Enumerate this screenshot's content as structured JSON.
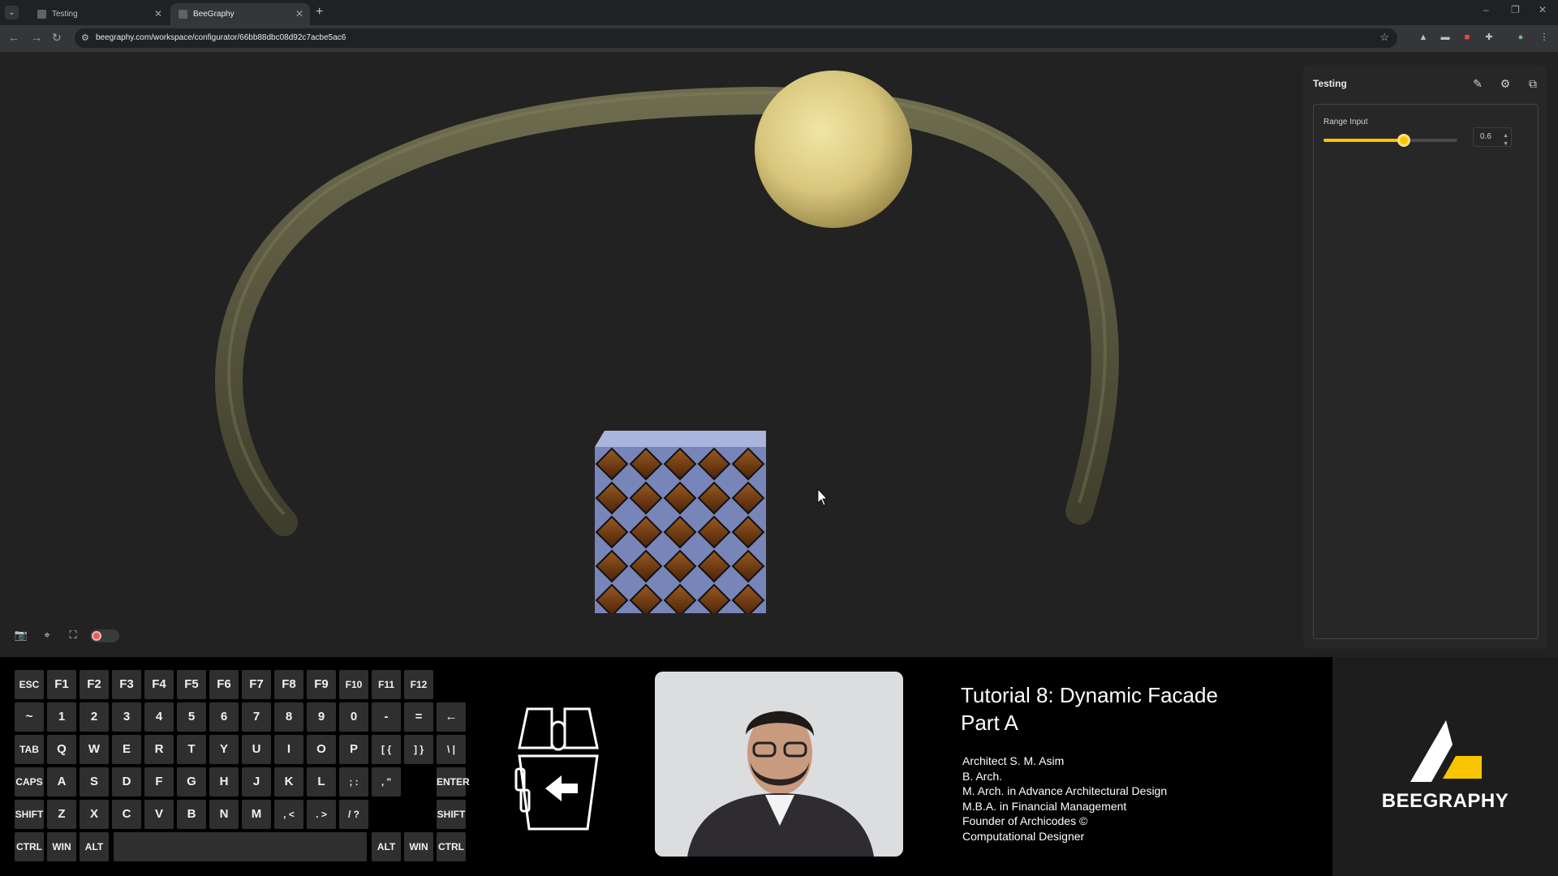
{
  "browser": {
    "tabs": [
      {
        "title": "Testing",
        "active": false
      },
      {
        "title": "BeeGraphy",
        "active": true
      }
    ],
    "url": "beegraphy.com/workspace/configurator/66bb88dbc08d92c7acbe5ac6"
  },
  "panel": {
    "title": "Testing",
    "range_input": {
      "label": "Range Input",
      "value": "0.6",
      "fill_fraction": 0.6
    }
  },
  "keyboard": {
    "rows": [
      [
        "ESC",
        "F1",
        "F2",
        "F3",
        "F4",
        "F5",
        "F6",
        "F7",
        "F8",
        "F9",
        "F10",
        "F11",
        "F12"
      ],
      [
        "~",
        "1",
        "2",
        "3",
        "4",
        "5",
        "6",
        "7",
        "8",
        "9",
        "0",
        "-",
        "=",
        "←"
      ],
      [
        "TAB",
        "Q",
        "W",
        "E",
        "R",
        "T",
        "Y",
        "U",
        "I",
        "O",
        "P",
        "[ {",
        "] }",
        "\\ |"
      ],
      [
        "CAPS",
        "A",
        "S",
        "D",
        "F",
        "G",
        "H",
        "J",
        "K",
        "L",
        "; :",
        ", \"",
        "ENTER"
      ],
      [
        "SHIFT",
        "Z",
        "X",
        "C",
        "V",
        "B",
        "N",
        "M",
        ", <",
        ". >",
        "/ ?",
        "SHIFT"
      ],
      [
        "CTRL",
        "WIN",
        "ALT",
        "ALT",
        "WIN",
        "CTRL"
      ]
    ]
  },
  "tutorial": {
    "title_line1": "Tutorial 8: Dynamic Facade",
    "title_line2": "Part A",
    "credits": [
      "Architect S. M. Asim",
      "B. Arch.",
      "M. Arch. in Advance Architectural Design",
      "M.B.A. in Financial Management",
      "Founder of Archicodes ©",
      "Computational Designer"
    ]
  },
  "brand": {
    "name": "BEEGRAPHY",
    "accent": "#f7c600"
  },
  "icons": [
    "tab-list-icon",
    "close-icon",
    "plus-icon",
    "back-icon",
    "forward-icon",
    "reload-icon",
    "site-info-icon",
    "star-icon",
    "pencil-icon",
    "gear-icon",
    "export-icon",
    "camera-icon",
    "recenter-icon",
    "fullscreen-icon",
    "mouse-icon"
  ]
}
